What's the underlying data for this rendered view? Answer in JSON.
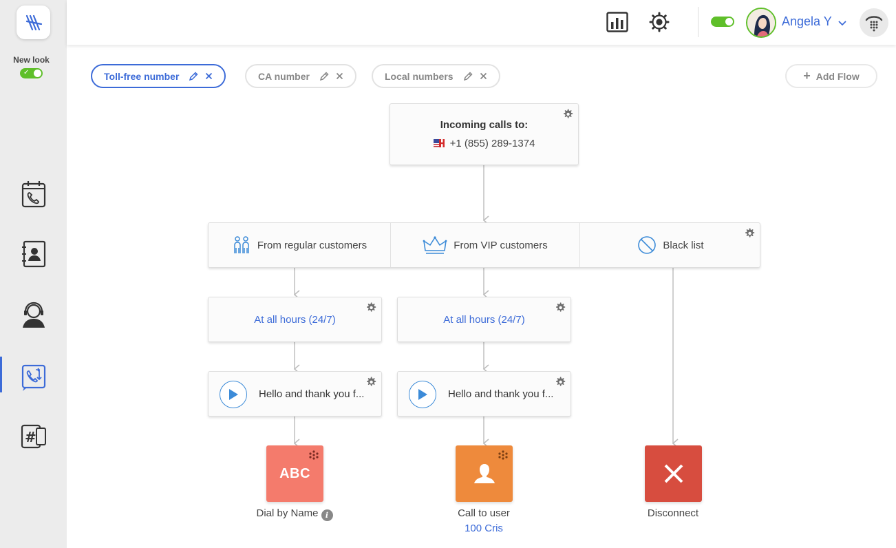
{
  "sidebar": {
    "new_look_label": "New look",
    "nav": [
      {
        "name": "call-history",
        "icon": "call-calendar-icon"
      },
      {
        "name": "contacts",
        "icon": "contact-book-icon"
      },
      {
        "name": "agent",
        "icon": "agent-headset-icon"
      },
      {
        "name": "call-flow",
        "icon": "call-flow-icon",
        "active": true
      },
      {
        "name": "numbers",
        "icon": "hash-numbers-icon"
      }
    ]
  },
  "header": {
    "user_name": "Angela Y",
    "status_on": true,
    "icons": [
      "analytics-icon",
      "settings-icon",
      "dialpad-icon"
    ]
  },
  "tabs": [
    {
      "label": "Toll-free number",
      "active": true
    },
    {
      "label": "CA number",
      "active": false
    },
    {
      "label": "Local numbers",
      "active": false
    }
  ],
  "add_flow_label": "Add Flow",
  "flow": {
    "incoming": {
      "title": "Incoming calls to:",
      "number": "+1 (855) 289-1374"
    },
    "filters": [
      {
        "label": "From regular customers",
        "icon": "people-icon"
      },
      {
        "label": "From VIP customers",
        "icon": "crown-icon"
      },
      {
        "label": "Black list",
        "icon": "block-icon"
      }
    ],
    "hours": [
      {
        "label": "At all hours (24/7)"
      },
      {
        "label": "At all hours (24/7)"
      }
    ],
    "greetings": [
      {
        "label": "Hello and thank you f..."
      },
      {
        "label": "Hello and thank you f..."
      }
    ],
    "actions": [
      {
        "label": "Dial by Name",
        "tile_text": "ABC",
        "color": "#f47b6c"
      },
      {
        "label": "Call to user",
        "sub": "100 Cris",
        "color": "#ee8a3c"
      },
      {
        "label": "Disconnect",
        "color": "#d74d3f"
      }
    ]
  },
  "colors": {
    "accent": "#3c6bd8",
    "toggle_green": "#5fbf2a"
  }
}
